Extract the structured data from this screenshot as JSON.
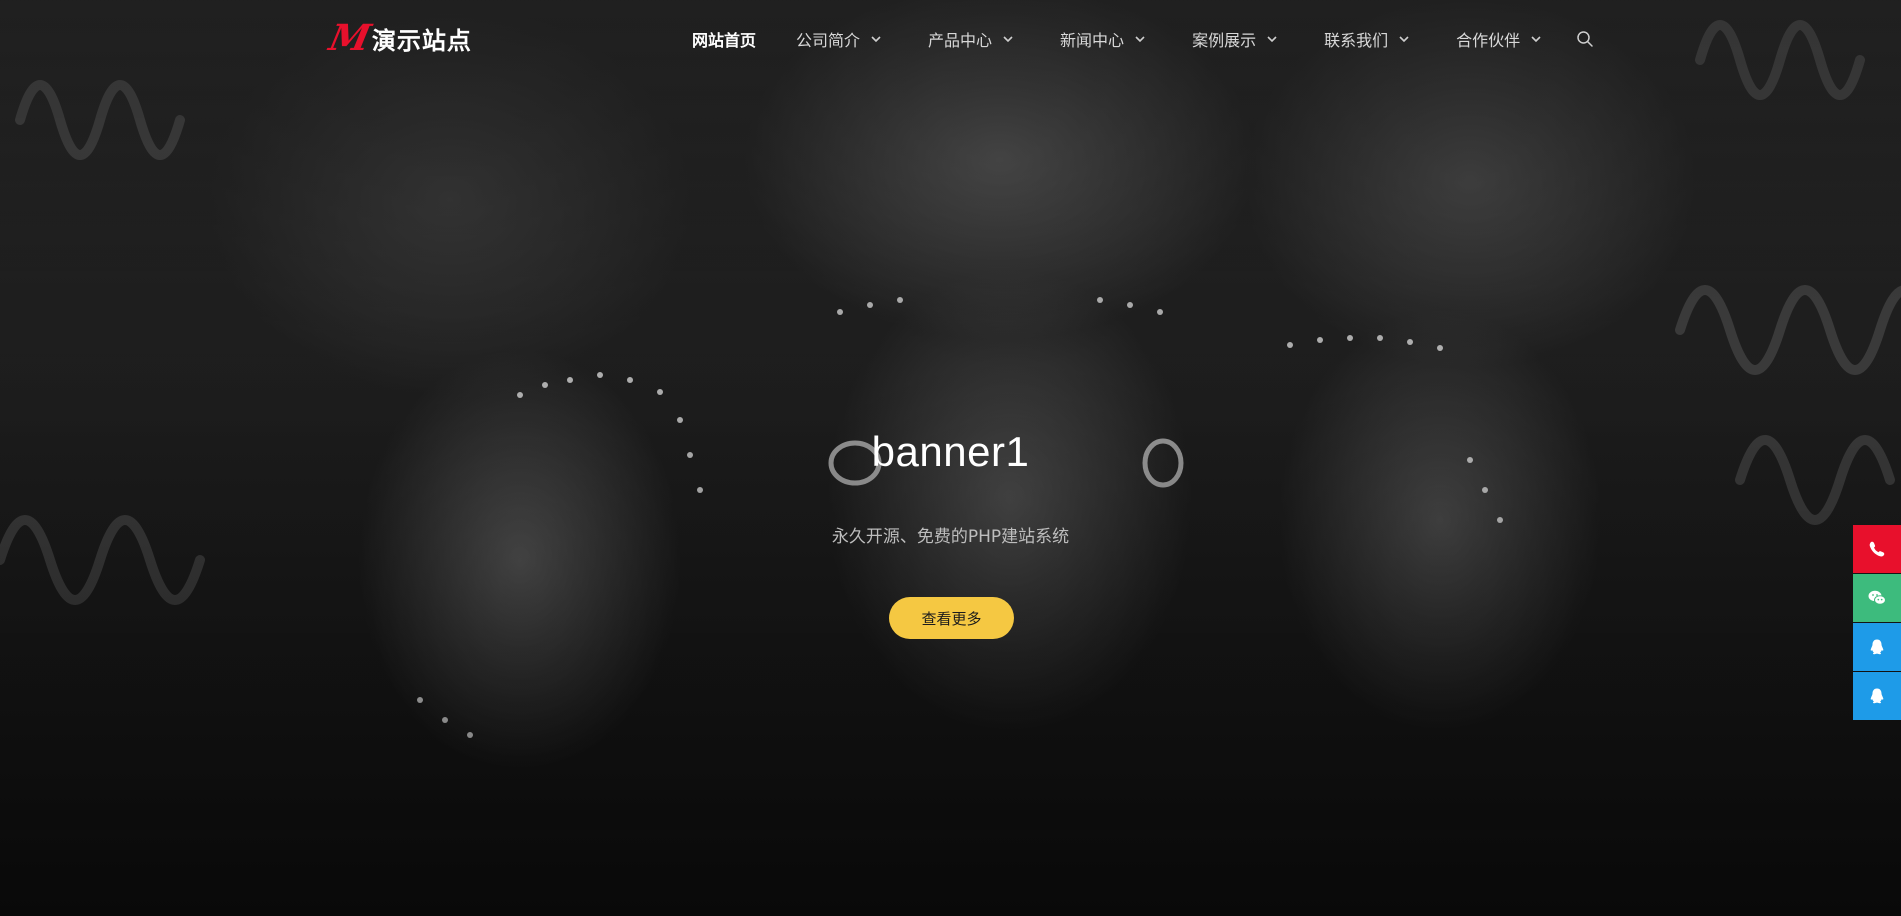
{
  "brand": {
    "logo_mark": "M",
    "site_name": "演示站点",
    "accent_color": "#e8102c"
  },
  "nav": {
    "items": [
      {
        "label": "网站首页",
        "active": true,
        "dropdown": false
      },
      {
        "label": "公司简介",
        "active": false,
        "dropdown": true
      },
      {
        "label": "产品中心",
        "active": false,
        "dropdown": true
      },
      {
        "label": "新闻中心",
        "active": false,
        "dropdown": true
      },
      {
        "label": "案例展示",
        "active": false,
        "dropdown": true
      },
      {
        "label": "联系我们",
        "active": false,
        "dropdown": true
      },
      {
        "label": "合作伙伴",
        "active": false,
        "dropdown": true
      }
    ],
    "search_icon": "search-icon"
  },
  "hero": {
    "title": "banner1",
    "subtitle": "永久开源、免费的PHP建站系统",
    "cta_label": "查看更多",
    "cta_color": "#f5c842"
  },
  "side_bar": {
    "buttons": [
      {
        "icon": "phone-icon",
        "color": "#e8102c"
      },
      {
        "icon": "wechat-icon",
        "color": "#3dbb7d"
      },
      {
        "icon": "qq-icon",
        "color": "#1e9be8"
      },
      {
        "icon": "qq-icon",
        "color": "#1e9be8"
      }
    ]
  }
}
